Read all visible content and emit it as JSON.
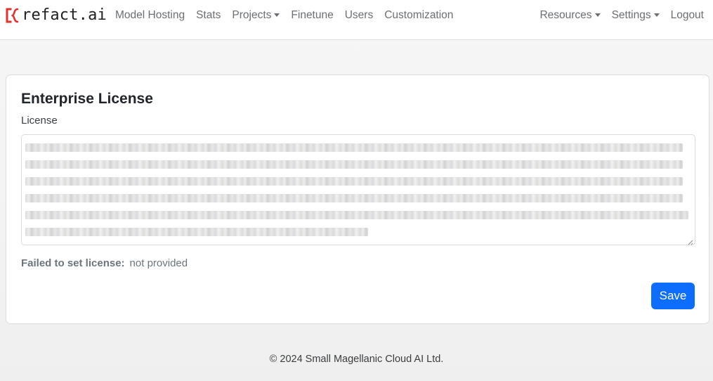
{
  "brand": {
    "name": "refact.ai",
    "icon": "refact-logo-icon",
    "accent_color": "#e0332f"
  },
  "nav": {
    "left": [
      {
        "label": "Model Hosting",
        "dropdown": false
      },
      {
        "label": "Stats",
        "dropdown": false
      },
      {
        "label": "Projects",
        "dropdown": true
      },
      {
        "label": "Finetune",
        "dropdown": false
      },
      {
        "label": "Users",
        "dropdown": false
      },
      {
        "label": "Customization",
        "dropdown": false
      }
    ],
    "right": [
      {
        "label": "Resources",
        "dropdown": true
      },
      {
        "label": "Settings",
        "dropdown": true
      },
      {
        "label": "Logout",
        "dropdown": false
      }
    ]
  },
  "card": {
    "title": "Enterprise License",
    "license_label": "License",
    "license_value_blurred": true,
    "status_label": "Failed to set license:",
    "status_value": "not provided",
    "save_label": "Save",
    "save_color": "#0d6efd"
  },
  "footer": {
    "copyright": "© 2024 Small Magellanic Cloud AI Ltd."
  }
}
